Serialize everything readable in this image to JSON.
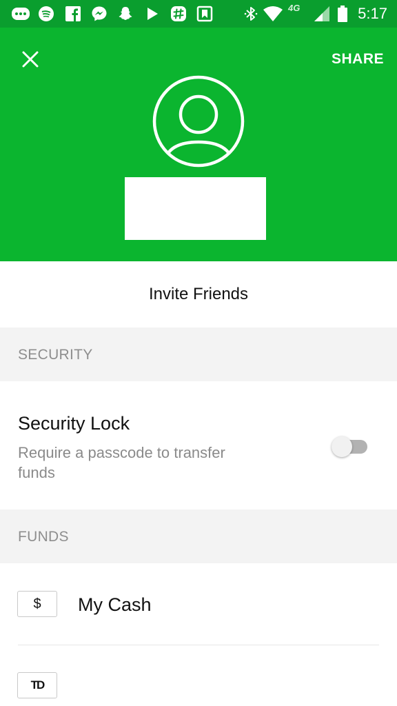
{
  "status_bar": {
    "time": "5:17",
    "network": "4G",
    "icons_left": [
      "more-horiz-icon",
      "spotify-icon",
      "facebook-icon",
      "messenger-icon",
      "snapchat-icon",
      "play-store-icon",
      "slack-icon",
      "bookmark-icon"
    ],
    "icons_right": [
      "bluetooth-icon",
      "wifi-icon",
      "cellular-signal-icon",
      "battery-icon"
    ]
  },
  "header": {
    "share_label": "SHARE",
    "close_icon": "close-icon",
    "avatar_icon": "person-icon",
    "bg_color": "#0bb52f"
  },
  "invite": {
    "label": "Invite Friends"
  },
  "security": {
    "section_title": "SECURITY",
    "lock_title": "Security Lock",
    "lock_description": "Require a passcode to transfer funds",
    "lock_enabled": false
  },
  "funds": {
    "section_title": "FUNDS",
    "items": [
      {
        "badge": "$",
        "label": "My Cash"
      },
      {
        "badge": "TD",
        "label": ""
      }
    ]
  }
}
